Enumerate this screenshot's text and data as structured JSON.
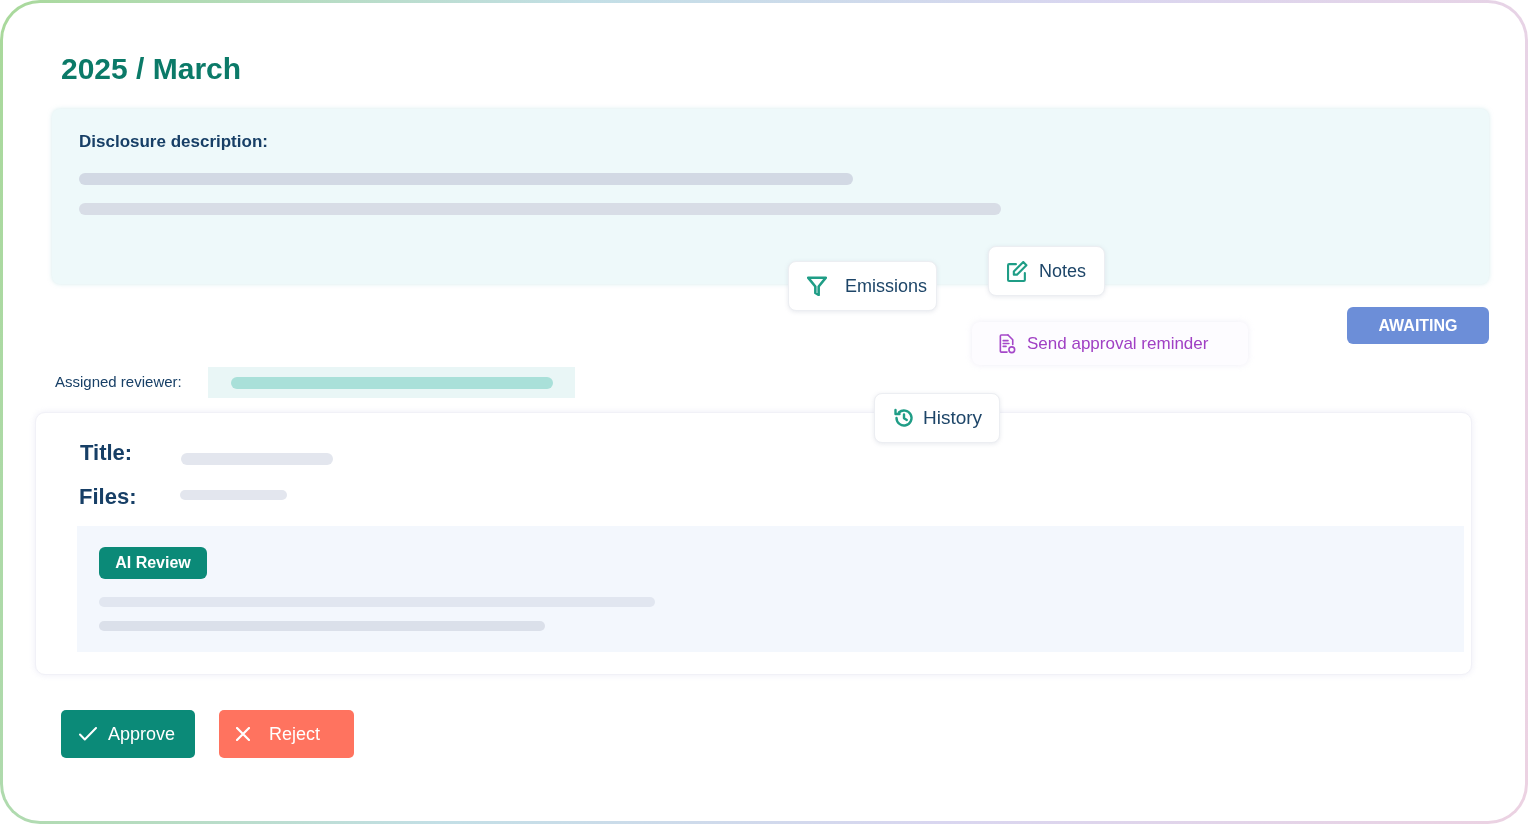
{
  "heading": "2025 / March",
  "disclosure": {
    "label": "Disclosure description:"
  },
  "emissions_button": {
    "label": "Emissions"
  },
  "notes_button": {
    "label": "Notes"
  },
  "status_badge": {
    "label": "AWAITING"
  },
  "reminder_link": {
    "label": "Send approval reminder"
  },
  "assigned_reviewer": {
    "label": "Assigned reviewer:"
  },
  "history_button": {
    "label": "History"
  },
  "details": {
    "title_label": "Title:",
    "files_label": "Files:"
  },
  "ai_review": {
    "badge": "AI Review"
  },
  "actions": [
    {
      "kind": "approve",
      "label": "Approve"
    },
    {
      "kind": "reject",
      "label": "Reject"
    }
  ]
}
